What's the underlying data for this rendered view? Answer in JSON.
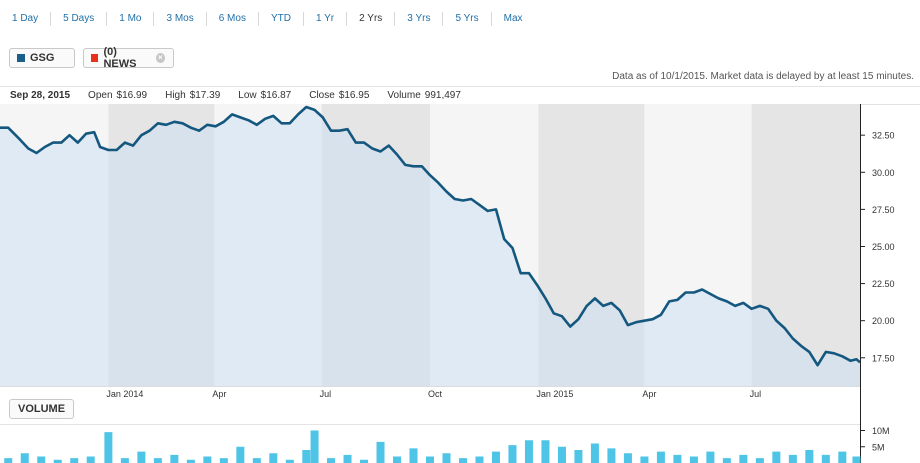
{
  "ranges": [
    "1 Day",
    "5 Days",
    "1 Mo",
    "3 Mos",
    "6 Mos",
    "YTD",
    "1 Yr",
    "2 Yrs",
    "3 Yrs",
    "5 Yrs",
    "Max"
  ],
  "active_range": "2 Yrs",
  "symbol_pill": {
    "label": "GSG",
    "color": "#1a5f8a"
  },
  "news_pill": {
    "label": "(0) NEWS",
    "color": "#e8311a",
    "close": "×"
  },
  "as_of": "Data as of 10/1/2015. Market data is delayed by at least 15 minutes.",
  "quote": {
    "date": "Sep 28, 2015",
    "open_label": "Open",
    "open": "$16.99",
    "high_label": "High",
    "high": "$17.39",
    "low_label": "Low",
    "low": "$16.87",
    "close_label": "Close",
    "close": "$16.95",
    "volume_label": "Volume",
    "volume": "991,497"
  },
  "volume_button": "VOLUME",
  "colors": {
    "line": "#14577f",
    "fill": "#e6ecf5",
    "band_dark": "#d6e5f5",
    "band_light": "#edf1f7",
    "volume": "#4ec4e6"
  },
  "chart_data": {
    "type": "line",
    "series": [
      {
        "name": "GSG"
      }
    ],
    "x_start": "2013-10-01",
    "x_end": "2015-10-01",
    "x_tick_labels": [
      "Jan 2014",
      "Apr",
      "Jul",
      "Oct",
      "Jan 2015",
      "Apr",
      "Jul"
    ],
    "x_tick_dates": [
      "2014-01-01",
      "2014-04-01",
      "2014-07-01",
      "2014-10-01",
      "2015-01-01",
      "2015-04-01",
      "2015-07-01"
    ],
    "y_ticks": [
      "32.50",
      "30.00",
      "27.50",
      "25.00",
      "22.50",
      "20.00",
      "17.50"
    ],
    "ylim": [
      15.6,
      34.6
    ],
    "points": [
      [
        "2013-10-01",
        33.0
      ],
      [
        "2013-10-08",
        33.0
      ],
      [
        "2013-10-18",
        32.2
      ],
      [
        "2013-10-25",
        31.6
      ],
      [
        "2013-11-01",
        31.3
      ],
      [
        "2013-11-08",
        31.7
      ],
      [
        "2013-11-15",
        32.0
      ],
      [
        "2013-11-22",
        32.0
      ],
      [
        "2013-11-29",
        32.5
      ],
      [
        "2013-12-06",
        32.0
      ],
      [
        "2013-12-13",
        32.6
      ],
      [
        "2013-12-20",
        32.7
      ],
      [
        "2013-12-25",
        31.7
      ],
      [
        "2014-01-01",
        31.5
      ],
      [
        "2014-01-08",
        31.5
      ],
      [
        "2014-01-15",
        32.0
      ],
      [
        "2014-01-22",
        31.8
      ],
      [
        "2014-01-29",
        32.5
      ],
      [
        "2014-02-05",
        32.8
      ],
      [
        "2014-02-12",
        33.3
      ],
      [
        "2014-02-19",
        33.2
      ],
      [
        "2014-02-26",
        33.4
      ],
      [
        "2014-03-05",
        33.3
      ],
      [
        "2014-03-12",
        33.0
      ],
      [
        "2014-03-19",
        32.8
      ],
      [
        "2014-03-26",
        33.2
      ],
      [
        "2014-04-02",
        33.1
      ],
      [
        "2014-04-09",
        33.4
      ],
      [
        "2014-04-16",
        33.9
      ],
      [
        "2014-04-23",
        33.7
      ],
      [
        "2014-04-30",
        33.5
      ],
      [
        "2014-05-07",
        33.2
      ],
      [
        "2014-05-14",
        33.6
      ],
      [
        "2014-05-21",
        33.8
      ],
      [
        "2014-05-28",
        33.3
      ],
      [
        "2014-06-04",
        33.3
      ],
      [
        "2014-06-11",
        33.9
      ],
      [
        "2014-06-18",
        34.4
      ],
      [
        "2014-06-25",
        34.2
      ],
      [
        "2014-07-02",
        33.7
      ],
      [
        "2014-07-09",
        32.8
      ],
      [
        "2014-07-16",
        32.8
      ],
      [
        "2014-07-23",
        32.9
      ],
      [
        "2014-07-30",
        32.0
      ],
      [
        "2014-08-06",
        32.0
      ],
      [
        "2014-08-13",
        31.6
      ],
      [
        "2014-08-20",
        31.4
      ],
      [
        "2014-08-27",
        31.8
      ],
      [
        "2014-09-03",
        31.2
      ],
      [
        "2014-09-10",
        30.5
      ],
      [
        "2014-09-17",
        30.4
      ],
      [
        "2014-09-24",
        30.4
      ],
      [
        "2014-10-01",
        29.8
      ],
      [
        "2014-10-08",
        29.3
      ],
      [
        "2014-10-15",
        28.7
      ],
      [
        "2014-10-22",
        28.2
      ],
      [
        "2014-10-29",
        28.1
      ],
      [
        "2014-11-05",
        28.2
      ],
      [
        "2014-11-12",
        27.8
      ],
      [
        "2014-11-19",
        27.4
      ],
      [
        "2014-11-26",
        27.5
      ],
      [
        "2014-12-03",
        25.5
      ],
      [
        "2014-12-10",
        24.9
      ],
      [
        "2014-12-17",
        23.2
      ],
      [
        "2014-12-24",
        23.2
      ],
      [
        "2014-12-31",
        22.4
      ],
      [
        "2015-01-07",
        21.5
      ],
      [
        "2015-01-14",
        20.5
      ],
      [
        "2015-01-21",
        20.3
      ],
      [
        "2015-01-28",
        19.6
      ],
      [
        "2015-02-04",
        20.1
      ],
      [
        "2015-02-11",
        21.0
      ],
      [
        "2015-02-18",
        21.5
      ],
      [
        "2015-02-25",
        21.0
      ],
      [
        "2015-03-04",
        21.2
      ],
      [
        "2015-03-11",
        20.7
      ],
      [
        "2015-03-18",
        19.7
      ],
      [
        "2015-03-25",
        19.9
      ],
      [
        "2015-04-01",
        20.0
      ],
      [
        "2015-04-08",
        20.1
      ],
      [
        "2015-04-15",
        20.4
      ],
      [
        "2015-04-22",
        21.3
      ],
      [
        "2015-04-29",
        21.4
      ],
      [
        "2015-05-06",
        21.9
      ],
      [
        "2015-05-13",
        21.9
      ],
      [
        "2015-05-20",
        22.1
      ],
      [
        "2015-05-27",
        21.8
      ],
      [
        "2015-06-03",
        21.5
      ],
      [
        "2015-06-10",
        21.3
      ],
      [
        "2015-06-17",
        21.0
      ],
      [
        "2015-06-24",
        21.2
      ],
      [
        "2015-07-01",
        20.8
      ],
      [
        "2015-07-08",
        21.0
      ],
      [
        "2015-07-15",
        20.8
      ],
      [
        "2015-07-22",
        20.0
      ],
      [
        "2015-07-29",
        19.5
      ],
      [
        "2015-08-05",
        18.8
      ],
      [
        "2015-08-12",
        18.3
      ],
      [
        "2015-08-19",
        17.9
      ],
      [
        "2015-08-26",
        17.0
      ],
      [
        "2015-09-02",
        17.9
      ],
      [
        "2015-09-09",
        17.8
      ],
      [
        "2015-09-16",
        17.6
      ],
      [
        "2015-09-23",
        17.3
      ],
      [
        "2015-09-28",
        17.4
      ],
      [
        "2015-10-01",
        17.2
      ]
    ],
    "volume": {
      "y_ticks": [
        "10M",
        "5M"
      ],
      "ylim": [
        0,
        12
      ],
      "bars": [
        [
          "2013-10-08",
          1.5
        ],
        [
          "2013-10-22",
          3.0
        ],
        [
          "2013-11-05",
          2.0
        ],
        [
          "2013-11-19",
          1.0
        ],
        [
          "2013-12-03",
          1.5
        ],
        [
          "2013-12-17",
          2.0
        ],
        [
          "2014-01-01",
          9.5
        ],
        [
          "2014-01-15",
          1.5
        ],
        [
          "2014-01-29",
          3.5
        ],
        [
          "2014-02-12",
          1.5
        ],
        [
          "2014-02-26",
          2.5
        ],
        [
          "2014-03-12",
          1.0
        ],
        [
          "2014-03-26",
          2.0
        ],
        [
          "2014-04-09",
          1.5
        ],
        [
          "2014-04-23",
          5.0
        ],
        [
          "2014-05-07",
          1.5
        ],
        [
          "2014-05-21",
          3.0
        ],
        [
          "2014-06-04",
          1.0
        ],
        [
          "2014-06-18",
          4.0
        ],
        [
          "2014-06-25",
          10.0
        ],
        [
          "2014-07-09",
          1.5
        ],
        [
          "2014-07-23",
          2.5
        ],
        [
          "2014-08-06",
          1.0
        ],
        [
          "2014-08-20",
          6.5
        ],
        [
          "2014-09-03",
          2.0
        ],
        [
          "2014-09-17",
          4.5
        ],
        [
          "2014-10-01",
          2.0
        ],
        [
          "2014-10-15",
          3.0
        ],
        [
          "2014-10-29",
          1.5
        ],
        [
          "2014-11-12",
          2.0
        ],
        [
          "2014-11-26",
          3.5
        ],
        [
          "2014-12-10",
          5.5
        ],
        [
          "2014-12-24",
          7.0
        ],
        [
          "2015-01-07",
          7.0
        ],
        [
          "2015-01-21",
          5.0
        ],
        [
          "2015-02-04",
          4.0
        ],
        [
          "2015-02-18",
          6.0
        ],
        [
          "2015-03-04",
          4.5
        ],
        [
          "2015-03-18",
          3.0
        ],
        [
          "2015-04-01",
          2.0
        ],
        [
          "2015-04-15",
          3.5
        ],
        [
          "2015-04-29",
          2.5
        ],
        [
          "2015-05-13",
          2.0
        ],
        [
          "2015-05-27",
          3.5
        ],
        [
          "2015-06-10",
          1.5
        ],
        [
          "2015-06-24",
          2.5
        ],
        [
          "2015-07-08",
          1.5
        ],
        [
          "2015-07-22",
          3.5
        ],
        [
          "2015-08-05",
          2.5
        ],
        [
          "2015-08-19",
          4.0
        ],
        [
          "2015-09-02",
          2.5
        ],
        [
          "2015-09-16",
          3.5
        ],
        [
          "2015-09-28",
          2.0
        ]
      ]
    }
  }
}
